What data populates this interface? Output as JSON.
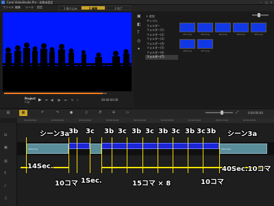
{
  "app": {
    "title": "Corel VideoStudio Pro - 名称未設定"
  },
  "menu": [
    "ファイル",
    "編集",
    "ツール",
    "設定"
  ],
  "steps": [
    {
      "num": "1",
      "label": "取り込み",
      "active": false
    },
    {
      "num": "2",
      "label": "編集",
      "active": true
    },
    {
      "num": "3",
      "label": "完了",
      "active": false
    }
  ],
  "player": {
    "project_label": "Project",
    "clip_label": "Clip",
    "timecode": "00:00:00:00"
  },
  "library": {
    "add_label": "追加",
    "folders": [
      "サンプル",
      "フォルダー",
      "フォルダー(1)",
      "フォルダー(2)",
      "フォルダー(3)",
      "フォルダー(4)",
      "フォルダー(5)",
      "フォルダー(6)",
      "フォルダー(7)"
    ],
    "active_folder_index": 8,
    "thumbs": [
      "e01.png",
      "e02.png",
      "e03.png",
      "e04.png",
      "e05.png",
      "e06.png",
      "e07.png"
    ]
  },
  "timeline": {
    "timecode": "0:00:00:00",
    "clip_name": "e01a.png",
    "ruler_labels": [
      "00:00:00:00",
      "00:00:10:00",
      "00:00:20:00",
      "00:00:30:00",
      "00:00:40:00",
      "00:00:50:00",
      "00:01:00:00",
      "00:01:10:00",
      "00:01:20:00"
    ]
  },
  "annotations": {
    "scene_left": "シーン3a",
    "scene_right": "シーン3a",
    "clip_labels": [
      "3b",
      "3c",
      "3b",
      "3c",
      "3b",
      "3c",
      "3b",
      "3c",
      "3b",
      "3c",
      "3b"
    ],
    "dur_left": "14Sec.",
    "dur_10koma_1": "10コマ",
    "dur_1sec": "1Sec.",
    "dur_15koma": "15コマ × 8",
    "dur_10koma_2": "10コマ",
    "dur_right": "40Sec.10コマ"
  },
  "colors": {
    "preview_bg": "#0018ff",
    "accent": "#c9a227",
    "overlay_line": "#ffe500",
    "clip_fill": "#5a8d9a"
  }
}
